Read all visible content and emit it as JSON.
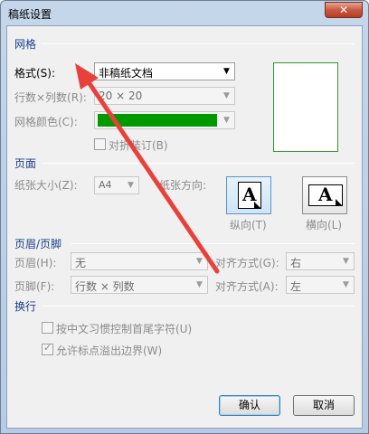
{
  "window": {
    "title": "稿纸设置",
    "close_glyph": "✕"
  },
  "grid": {
    "section": "网格",
    "format_label": "格式(S):",
    "format_value": "非稿纸文档",
    "rowcol_label": "行数×列数(R):",
    "rowcol_value": "20 × 20",
    "color_label": "网格颜色(C):",
    "color_value": "#009a00",
    "align_label": "对折装订(B)"
  },
  "page": {
    "section": "页面",
    "size_label": "纸张大小(Z):",
    "size_value": "A4",
    "orientation_label": "纸张方向:",
    "portrait_label": "纵向(T)",
    "landscape_label": "横向(L)",
    "page_letter": "A"
  },
  "header_footer": {
    "section": "页眉/页脚",
    "header_label": "页眉(H):",
    "header_value": "无",
    "header_align_label": "对齐方式(G):",
    "header_align_value": "右",
    "footer_label": "页脚(F):",
    "footer_value": "行数 × 列数",
    "footer_align_label": "对齐方式(A):",
    "footer_align_value": "左"
  },
  "line_break": {
    "section": "换行",
    "option1": "按中文习惯控制首尾字符(U)",
    "option2": "允许标点溢出边界(W)"
  },
  "buttons": {
    "ok": "确认",
    "cancel": "取消"
  },
  "icons": {
    "dropdown": "▼",
    "check": "✓"
  },
  "colors": {
    "section_text": "#1a3f8a",
    "annotation_arrow": "#e8413b"
  }
}
